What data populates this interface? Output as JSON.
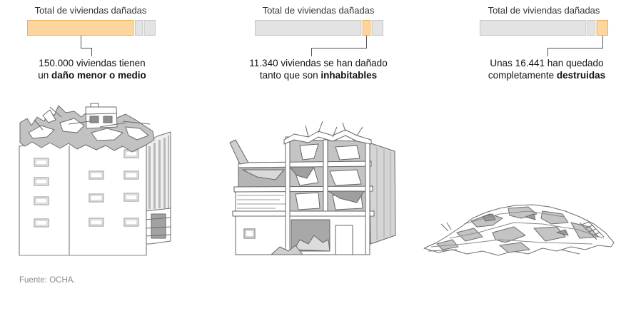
{
  "colors": {
    "highlight_fill": "#fdd69f",
    "highlight_stroke": "#f2ae55",
    "segment_fill": "#e3e3e3",
    "segment_stroke": "#c6c6c6",
    "leader_line": "#555555"
  },
  "chart_data": [
    {
      "type": "bar",
      "orientation": "horizontal",
      "stacked": true,
      "title": "Total de viviendas dañadas",
      "values": [
        150000,
        11340,
        16441
      ],
      "highlighted_segment": 0
    },
    {
      "type": "bar",
      "orientation": "horizontal",
      "stacked": true,
      "title": "Total de viviendas dañadas",
      "values": [
        150000,
        11340,
        16441
      ],
      "highlighted_segment": 1
    },
    {
      "type": "bar",
      "orientation": "horizontal",
      "stacked": true,
      "title": "Total de viviendas dañadas",
      "values": [
        150000,
        11340,
        16441
      ],
      "highlighted_segment": 2
    }
  ],
  "panels": [
    {
      "line1": "150.000 viviendas tienen",
      "line2_prefix": "un ",
      "line2_bold": "daño menor o medio",
      "illustration_icon": "damaged-building-icon"
    },
    {
      "line1": "11.340 viviendas se han dañado",
      "line2_prefix": "tanto que son ",
      "line2_bold": "inhabitables",
      "illustration_icon": "gutted-building-icon"
    },
    {
      "line1": "Unas 16.441 han quedado",
      "line2_prefix": "completamente ",
      "line2_bold": "destruidas",
      "illustration_icon": "rubble-pile-icon"
    }
  ],
  "source": "Fuente: OCHA."
}
